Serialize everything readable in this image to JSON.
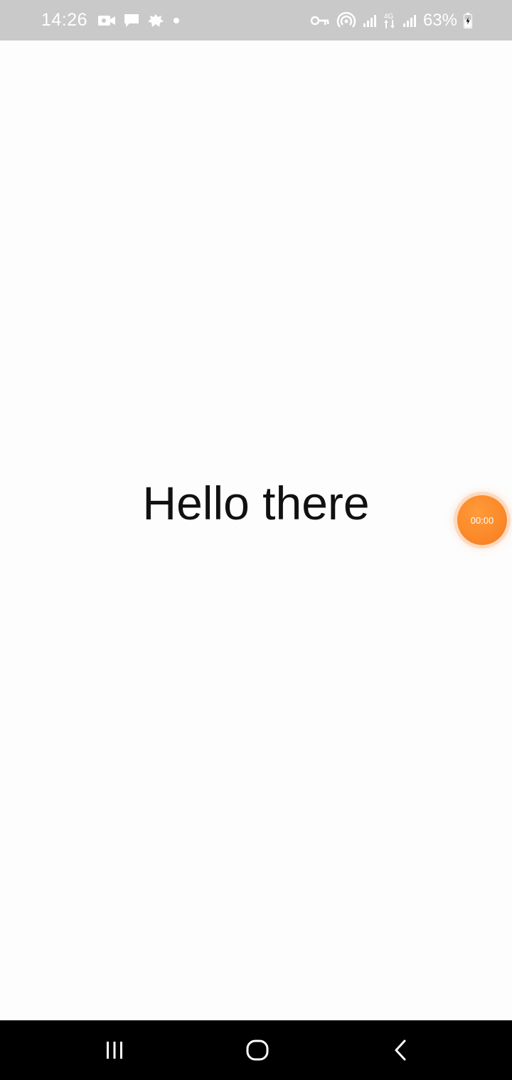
{
  "status_bar": {
    "time": "14:26",
    "battery_percent": "63%",
    "left_icons": [
      "video-camera-icon",
      "message-icon",
      "app-notification-icon",
      "dot-icon"
    ],
    "right_icons": [
      "vpn-key-icon",
      "hotspot-icon",
      "signal-icon",
      "4g-data-icon",
      "signal-icon",
      "battery-icon"
    ],
    "network_label": "4G",
    "battery_level": 0.63,
    "background_color": "#c9c9c9"
  },
  "main": {
    "greeting": "Hello there"
  },
  "timer": {
    "label": "00:00",
    "color": "#fb8a2a"
  },
  "nav_bar": {
    "buttons": [
      "recents-icon",
      "home-icon",
      "back-icon"
    ],
    "background_color": "#000000"
  }
}
